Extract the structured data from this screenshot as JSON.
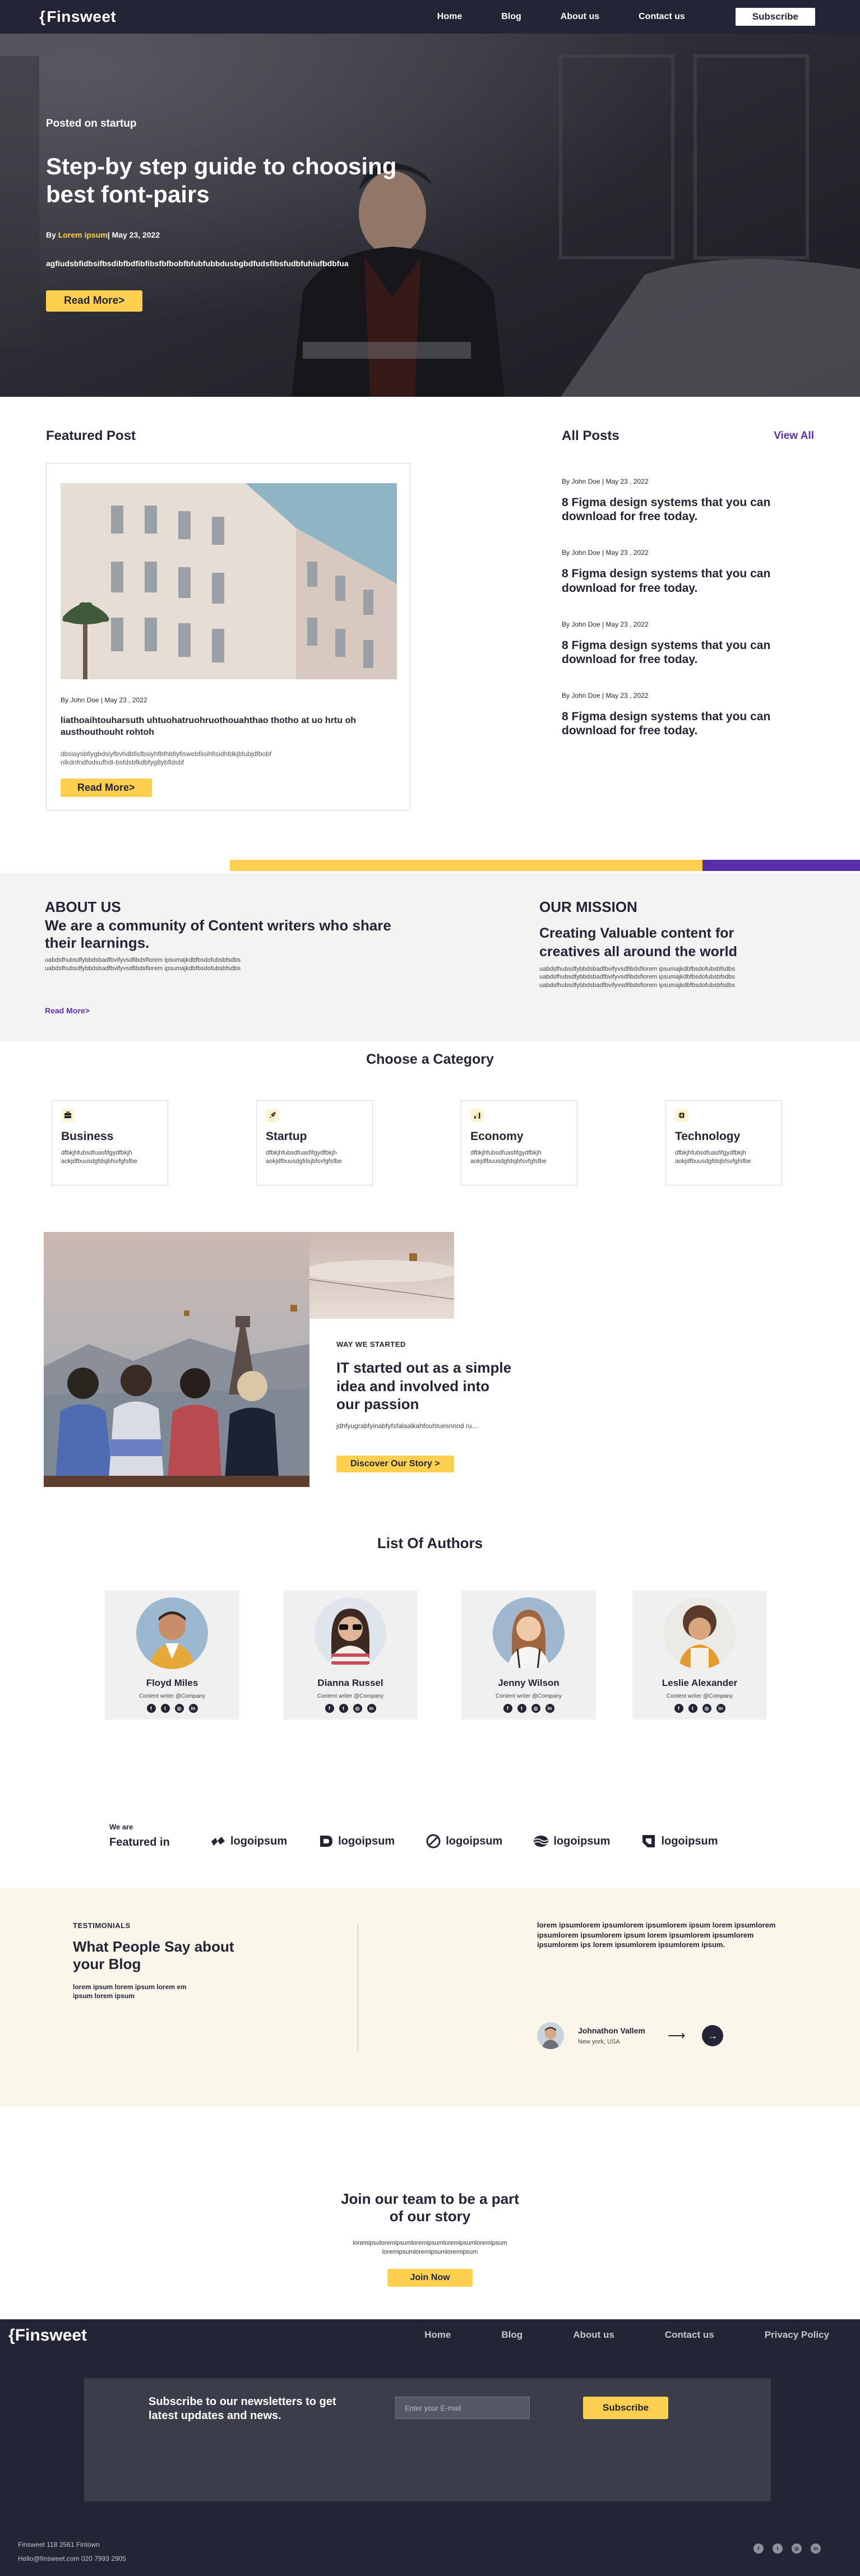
{
  "nav": {
    "logo": "Finsweet",
    "links": [
      "Home",
      "Blog",
      "About us",
      "Contact us"
    ],
    "subscribe": "Subscribe"
  },
  "hero": {
    "posted": "Posted on startup",
    "title": "Step-by step guide to choosing best font-pairs",
    "by": "By",
    "author": "Lorem ipsum",
    "date": "| May 23, 2022",
    "desc": "agfiudsbfidbsifbsdibfbdfibfibsfbfbobfbfubfubbdusbgbdfudsfibsfudbfuhiufbdbfua",
    "button": "Read More>"
  },
  "featured": {
    "heading": "Featured Post",
    "meta": "By John Doe | May 23 , 2022",
    "title": "liathoaihtouharsuth uhtuohatruohruothouahthao thotho at uo hrtu oh austhouthouht rohtoh",
    "desc": "dbsiaysbfiygbdsiyfbvhdbfisfbsiyhfbfhbfiyfiswebfiisihfisidhfdkjbfubjdfbobf nlkdnfndfodsufhdl-bsfdsbfkdbfyg8ybfldsbf",
    "button": "Read More>"
  },
  "allposts": {
    "heading": "All Posts",
    "viewall": "View All",
    "items": [
      {
        "meta": "By John Doe | May 23 , 2022",
        "title": "8 Figma design  systems that you can download for free today."
      },
      {
        "meta": "By John Doe | May 23 , 2022",
        "title": "8 Figma design  systems that you can download for free today."
      },
      {
        "meta": "By John Doe | May 23 , 2022",
        "title": "8 Figma design  systems that you can download for free today."
      },
      {
        "meta": "By John Doe | May 23 , 2022",
        "title": "8 Figma design  systems that you can download for free today."
      }
    ]
  },
  "about": {
    "label": "ABOUT US",
    "heading": "We are a community of Content writers who share their learnings.",
    "small1": "uabdsfhubsdfybbdsbadfbvifyvsdfibdsflorem ipsumajkdbfbsdofubsbfsdbs",
    "small2": "uabdsfhubsdfybbdsbadfbvifyvsdfibdsflorem ipsumajkdbfbsdofubsbfsdbs",
    "readmore": "Read More>",
    "mission_label": "OUR MISSION",
    "mission_heading": "Creating Valuable content for creatives all around the world",
    "mission_small": [
      "uabdsfhubsdfybbdsbadfbvifyvsdfibdsflorem ipsumajkdbfbsdofubsbfsdbs",
      "uabdsfhubsdfybbdsbadfbvifyvsdfibdsflorem ipsumajkdbfbsdofubsbfsdbs",
      "uabdsfhubsdfybbdsbadfbvifyvsdfibdsflorem ipsumajkdbfbsdofubsbfsdbs"
    ]
  },
  "category": {
    "heading": "Choose a Category",
    "items": [
      {
        "name": "Business",
        "icon": "briefcase-icon",
        "desc": "dfbkjhfubsdfuasfifgydfbkjh aokjdfbuusdgfdsjbfsvfgfsfbe"
      },
      {
        "name": "Startup",
        "icon": "rocket-icon",
        "desc": "dfbkjhfubsdfuasfifgydfbkjh aokjdfbuusdgfdsjbfsvfgfsfbe"
      },
      {
        "name": "Economy",
        "icon": "chart-icon",
        "desc": "dfbkjhfubsdfuasfifgydfbkjh aokjdfbuusdgfdsjbfsvfgfsfbe"
      },
      {
        "name": "Technology",
        "icon": "cpu-icon",
        "desc": "dfbkjhfubsdfuasfifgydfbkjh aokjdfbuusdgfdsjbfsvfgfsfbe"
      }
    ]
  },
  "story": {
    "label": "WAY WE STARTED",
    "title": "IT started out as a simple idea and involved into  our passion",
    "desc": "jdhfyugrabfyinabfyfsfalaalkahfouhtuesnnnd ru...",
    "button": "Discover Our Story >"
  },
  "authors": {
    "heading": "List Of Authors",
    "items": [
      {
        "name": "Floyd Miles",
        "role": "Content writer @Company"
      },
      {
        "name": "Dianna Russel",
        "role": "Content writer @Company"
      },
      {
        "name": "Jenny Wilson",
        "role": "Content writer @Company"
      },
      {
        "name": "Leslie Alexander",
        "role": "Content writer @Company"
      }
    ]
  },
  "featuredin": {
    "label1": "We are",
    "label2": "Featured in",
    "logos": [
      "logoipsum",
      "logoipsum",
      "logoipsum",
      "logoipsum",
      "logoipsum"
    ]
  },
  "testimonials": {
    "label": "TESTIMONIALS",
    "heading": "What People Say about your Blog",
    "small": "lorem ipsum lorem ipsum lorem em ipsum lorem ipsum",
    "quote": "lorem ipsumlorem ipsumlorem ipsumlorem ipsum lorem ipsumlorem ipsumlorem ipsumlorem ipsum lorem ipsumlorem ipsumlorem ipsumlorem ips lorem ipsumlorem ipsumlorem ipsum.",
    "name": "Johnathon Vallem",
    "location": "New york, USA"
  },
  "join": {
    "title": "Join our team to be a  part of our story",
    "desc": "loremipsuloremipsumloremipsumloremipsumloremipsum loremipsumloremipsumloremipsum",
    "button": "Join Now"
  },
  "footer": {
    "logo": "Finsweet",
    "links": [
      "Home",
      "Blog",
      "About us",
      "Contact us",
      "Privacy Policy"
    ],
    "newsletter_text": "Subscribe to our newsletters to get latest updates and news.",
    "email_placeholder": "Enter your E-mail",
    "subscribe": "Subscribe",
    "address": "Finsweet 118 2561 Fintown",
    "contact": "Hello@finsweet.com 020 7993 2905"
  },
  "colors": {
    "dark": "#232536",
    "yellow": "#FFD050",
    "purple": "#592EA9",
    "light": "#f3f3f3",
    "cream": "#fbf6ea"
  }
}
